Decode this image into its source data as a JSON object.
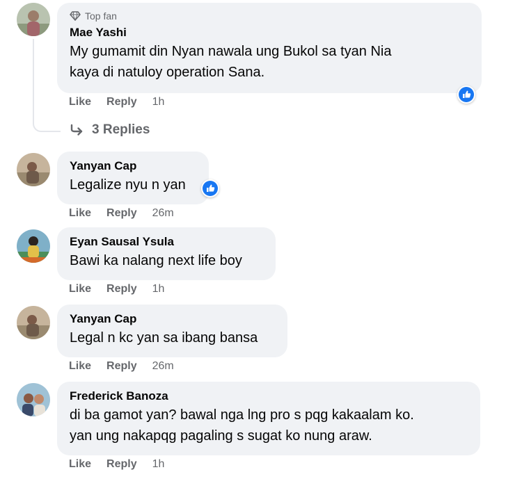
{
  "comments": [
    {
      "badge": "Top fan",
      "author": "Mae Yashi",
      "text_lines": [
        "My gumamit din Nyan nawala ung Bukol sa tyan Nia",
        "kaya di natuloy operation Sana."
      ],
      "like": "Like",
      "reply": "Reply",
      "time": "1h",
      "replies": "3 Replies"
    },
    {
      "author": "Yanyan Cap",
      "text_lines": [
        "Legalize nyu n yan"
      ],
      "like": "Like",
      "reply": "Reply",
      "time": "26m"
    },
    {
      "author": "Eyan Sausal Ysula",
      "text_lines": [
        "Bawi ka nalang next life boy"
      ],
      "like": "Like",
      "reply": "Reply",
      "time": "1h"
    },
    {
      "author": "Yanyan Cap",
      "text_lines": [
        "Legal n kc yan sa ibang bansa"
      ],
      "like": "Like",
      "reply": "Reply",
      "time": "26m"
    },
    {
      "author": "Frederick Banoza",
      "text_lines": [
        "di ba gamot yan? bawal nga lng pro s pqg kakaalam ko.",
        "yan ung nakapqg pagaling s sugat ko nung araw."
      ],
      "like": "Like",
      "reply": "Reply",
      "time": "1h"
    }
  ],
  "colors": {
    "bubble": "#f0f2f5",
    "secondary_text": "#65676b",
    "like_blue": "#1877f2"
  },
  "icons": {
    "badge": "diamond-icon",
    "reaction": "like-reaction-icon",
    "reply_arrow": "reply-arrow-icon"
  }
}
